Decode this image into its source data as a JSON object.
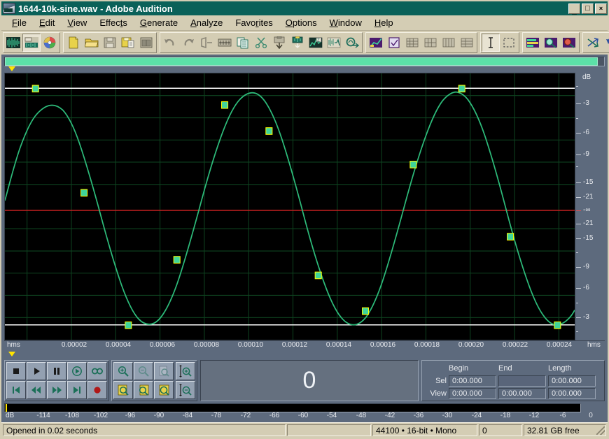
{
  "window": {
    "title": "1644-10k-sine.wav - Adobe Audition",
    "icon": "audition-app-icon",
    "buttons": {
      "minimize": "_",
      "maximize": "□",
      "close": "×"
    }
  },
  "menu": {
    "items": [
      {
        "label": "File",
        "accel": "F"
      },
      {
        "label": "Edit",
        "accel": "E"
      },
      {
        "label": "View",
        "accel": "V"
      },
      {
        "label": "Effects",
        "accel": "t"
      },
      {
        "label": "Generate",
        "accel": "G"
      },
      {
        "label": "Analyze",
        "accel": "A"
      },
      {
        "label": "Favorites",
        "accel": "r"
      },
      {
        "label": "Options",
        "accel": "O"
      },
      {
        "label": "Window",
        "accel": "W"
      },
      {
        "label": "Help",
        "accel": "H"
      }
    ]
  },
  "toolbar": {
    "groups": [
      {
        "name": "view-mode",
        "buttons": [
          {
            "icon": "edit-view-waveform-icon",
            "active": false
          },
          {
            "icon": "multitrack-view-icon",
            "active": true
          },
          {
            "icon": "cd-view-icon",
            "active": false
          }
        ]
      },
      {
        "name": "file-ops",
        "buttons": [
          {
            "icon": "new-file-icon",
            "active": false
          },
          {
            "icon": "open-file-icon",
            "active": false
          },
          {
            "icon": "save-file-icon",
            "active": false
          },
          {
            "icon": "save-as-icon",
            "active": false
          },
          {
            "icon": "close-file-icon",
            "active": false
          }
        ]
      },
      {
        "name": "edit-ops",
        "buttons": [
          {
            "icon": "undo-icon",
            "active": false
          },
          {
            "icon": "redo-icon",
            "active": false
          },
          {
            "icon": "trim-icon",
            "active": false
          },
          {
            "icon": "mixdown-icon",
            "active": false
          },
          {
            "icon": "copy-icon",
            "active": false
          },
          {
            "icon": "cut-scissors-icon",
            "active": false
          },
          {
            "icon": "paste-icon",
            "active": false
          },
          {
            "icon": "mix-paste-icon",
            "active": false
          },
          {
            "icon": "frequency-analysis-icon",
            "active": false
          },
          {
            "icon": "noise-reduction-icon",
            "active": false
          },
          {
            "icon": "amplify-icon",
            "active": false
          }
        ]
      },
      {
        "name": "view-toggles",
        "buttons": [
          {
            "icon": "spectral-view-icon",
            "active": false
          },
          {
            "icon": "checkbox-toggle-icon",
            "active": false
          },
          {
            "icon": "show-grid-icon",
            "active": false
          },
          {
            "icon": "snap-grid-icon",
            "active": false
          },
          {
            "icon": "grid-lines-icon",
            "active": false
          },
          {
            "icon": "grid-alt-icon",
            "active": false
          }
        ]
      },
      {
        "name": "select-tools",
        "buttons": [
          {
            "icon": "text-cursor-tool-icon",
            "active": true
          },
          {
            "icon": "marquee-select-tool-icon",
            "active": false
          }
        ]
      },
      {
        "name": "display-tools",
        "buttons": [
          {
            "icon": "level-meters-icon",
            "active": false
          },
          {
            "icon": "zoom-spectrum-icon",
            "active": false
          },
          {
            "icon": "phase-analysis-icon",
            "active": false
          }
        ]
      },
      {
        "name": "effects-rack",
        "buttons": [
          {
            "icon": "transform-icon",
            "active": false
          },
          {
            "icon": "reverse-icon",
            "active": false
          },
          {
            "icon": "dc-offset-icon",
            "active": false
          },
          {
            "icon": "reverb-icon",
            "active": false
          },
          {
            "icon": "filter-icon",
            "active": false
          }
        ]
      }
    ]
  },
  "range_bar": {
    "name": "horizontal-range-scrollbar",
    "thumb_color": "#5ce0a8",
    "thumb_start_pct": 0,
    "thumb_width_pct": 99
  },
  "marker": {
    "top_marker_x_pct": 1.2,
    "bottom_marker_x_pct": 1.2,
    "color": "#ffe400"
  },
  "chart_data": {
    "type": "line",
    "title": "1644-10k-sine.wav waveform",
    "xlabel": "hms",
    "ylabel": "dB",
    "grid": true,
    "background": "#000000",
    "xlim": [
      0,
      0.0002572
    ],
    "ylim": [
      -1,
      1
    ],
    "x_ticks": [
      "0.00002",
      "0.00004",
      "0.00006",
      "0.00008",
      "0.00010",
      "0.00012",
      "0.00014",
      "0.00016",
      "0.00018",
      "0.00020",
      "0.00022",
      "0.00024"
    ],
    "x_tick_values": [
      2e-05,
      4e-05,
      6e-05,
      8e-05,
      0.0001,
      0.00012,
      0.00014,
      0.00016,
      0.00018,
      0.0002,
      0.00022,
      0.00024
    ],
    "x_edge_label_left": "hms",
    "x_edge_label_right": "hms",
    "y_axis_header": "dB",
    "y_ticks": [
      {
        "label": "-3",
        "pos_pct": 11.5
      },
      {
        "label": "-6",
        "pos_pct": 22.5
      },
      {
        "label": "-9",
        "pos_pct": 30.5
      },
      {
        "label": "-15",
        "pos_pct": 41.0
      },
      {
        "label": "-21",
        "pos_pct": 46.5
      },
      {
        "label": "-∞",
        "pos_pct": 51.5
      },
      {
        "label": "-21",
        "pos_pct": 56.5
      },
      {
        "label": "-15",
        "pos_pct": 62.0
      },
      {
        "label": "-9",
        "pos_pct": 72.5
      },
      {
        "label": "-6",
        "pos_pct": 80.5
      },
      {
        "label": "-3",
        "pos_pct": 91.5
      }
    ],
    "zero_line_color": "#cc2222",
    "clip_line_color": "#ffffff",
    "grid_color": "#124a22",
    "series": [
      {
        "name": "sine-wave",
        "color": "#2dbb7a",
        "type": "continuous-sine",
        "frequency_hz": 10000,
        "sample_rate_hz": 44100,
        "amplitude": 0.885,
        "phase_deg": 38
      },
      {
        "name": "sample-and-hold-steps",
        "color": "#ffff00",
        "type": "step",
        "marker": "square",
        "marker_color": "#3fd49b",
        "sample_x": [
          6.8e-06,
          2.95e-05,
          5.22e-05,
          7.48e-05,
          9.75e-05,
          0.0001202,
          0.0001429,
          0.0001655,
          0.0001882,
          0.0002109,
          0.0002336,
          0.0002563
        ],
        "sample_y": [
          0.885,
          0.3,
          -0.885,
          -0.3,
          0.885,
          0.6,
          -0.6,
          -0.885,
          0.3,
          0.885,
          -0.3,
          -0.885
        ]
      }
    ]
  },
  "transport": {
    "playback_buttons": [
      {
        "icon": "stop-icon",
        "label": "Stop"
      },
      {
        "icon": "play-icon",
        "label": "Play"
      },
      {
        "icon": "pause-icon",
        "label": "Pause"
      },
      {
        "icon": "play-to-end-icon",
        "label": "Play to End"
      },
      {
        "icon": "loop-play-icon",
        "label": "Loop Play"
      },
      {
        "icon": "go-to-beginning-icon",
        "label": "Go to Beginning"
      },
      {
        "icon": "rewind-icon",
        "label": "Rewind"
      },
      {
        "icon": "fast-forward-icon",
        "label": "Fast Forward"
      },
      {
        "icon": "go-to-end-icon",
        "label": "Go to End"
      },
      {
        "icon": "record-icon",
        "label": "Record"
      }
    ],
    "zoom_buttons": [
      {
        "icon": "zoom-in-horizontal-icon",
        "enabled": true
      },
      {
        "icon": "zoom-out-horizontal-icon",
        "enabled": false
      },
      {
        "icon": "zoom-out-full-icon",
        "enabled": false
      },
      {
        "icon": "zoom-to-selection-left-icon",
        "enabled": true
      },
      {
        "icon": "zoom-to-selection-right-icon",
        "enabled": true
      },
      {
        "icon": "zoom-to-selection-icon",
        "enabled": true
      }
    ],
    "vertical_zoom_buttons": [
      {
        "icon": "zoom-in-vertical-icon",
        "enabled": true
      },
      {
        "icon": "zoom-out-vertical-icon",
        "enabled": true
      }
    ],
    "time_display": "0"
  },
  "selview": {
    "headers": [
      "Begin",
      "End",
      "Length"
    ],
    "rows": [
      {
        "label": "Sel",
        "begin": "0:00.000",
        "end": "",
        "length": "0:00.000"
      },
      {
        "label": "View",
        "begin": "0:00.000",
        "end": "0:00.000",
        "length": "0:00.000"
      }
    ]
  },
  "level_meter": {
    "unit": "dB",
    "ticks": [
      "-114",
      "-108",
      "-102",
      "-96",
      "-90",
      "-84",
      "-78",
      "-72",
      "-66",
      "-60",
      "-54",
      "-48",
      "-42",
      "-36",
      "-30",
      "-24",
      "-18",
      "-12",
      "-6",
      "0"
    ],
    "min": -120,
    "max": 0
  },
  "statusbar": {
    "message": "Opened in 0.02 seconds",
    "secondary": "",
    "format": "44100 • 16-bit • Mono",
    "size": "0",
    "free_space": "32.81 GB free"
  }
}
